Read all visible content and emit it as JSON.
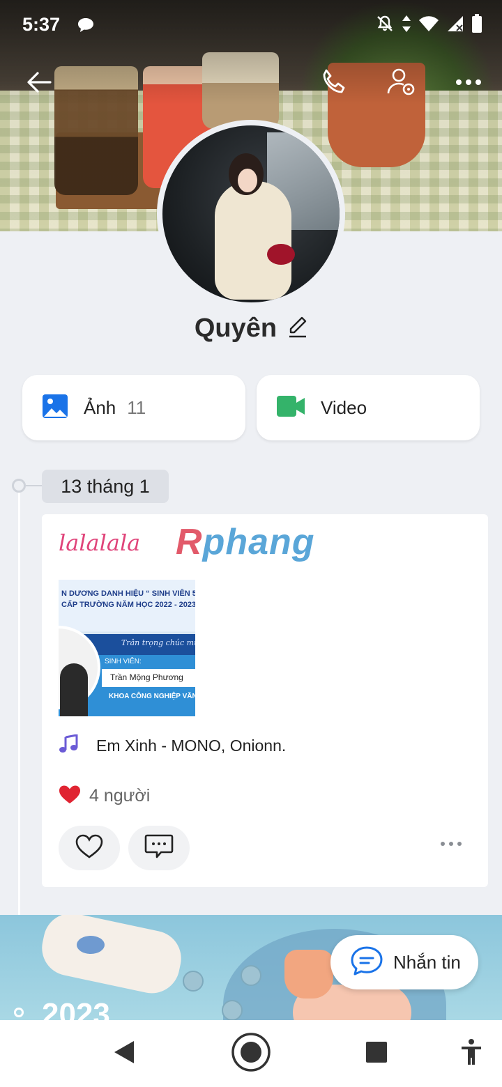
{
  "status_bar": {
    "time": "5:37",
    "icons": [
      "chat-bubble-icon",
      "bell-off-icon",
      "data-arrows-icon",
      "wifi-icon",
      "signal-icon",
      "battery-icon"
    ]
  },
  "top_bar": {
    "icons": [
      "back-arrow-icon",
      "phone-icon",
      "user-settings-icon",
      "more-icon"
    ]
  },
  "profile": {
    "name": "Quyên"
  },
  "media": {
    "photos_label": "Ảnh",
    "photos_count": "11",
    "video_label": "Video"
  },
  "timeline": {
    "date": "13 tháng 1",
    "post": {
      "caption": "lalalala",
      "logo_text_r": "R",
      "logo_text_rest": "phang",
      "image_text": {
        "line1": "N DƯƠNG DANH HIỆU “ SINH VIÊN 5",
        "line2": "CẤP TRƯỜNG NĂM HỌC 2022 - 2023",
        "line3": "Trân trọng chúc mừ",
        "line4": "SINH VIÊN:",
        "student_name": "Trần Mộng Phương",
        "line5": "KHOA CÔNG NGHIỆP VĂN"
      },
      "song": "Em Xinh - MONO, Onionn.",
      "likes": "4 người"
    },
    "year": "2023"
  },
  "fab": {
    "label": "Nhắn tin"
  },
  "colors": {
    "photo_icon": "#1a73e8",
    "video_icon": "#34b36a",
    "music_icon": "#6b5bd6",
    "heart": "#e02432",
    "chat_fab": "#1a73e8"
  }
}
